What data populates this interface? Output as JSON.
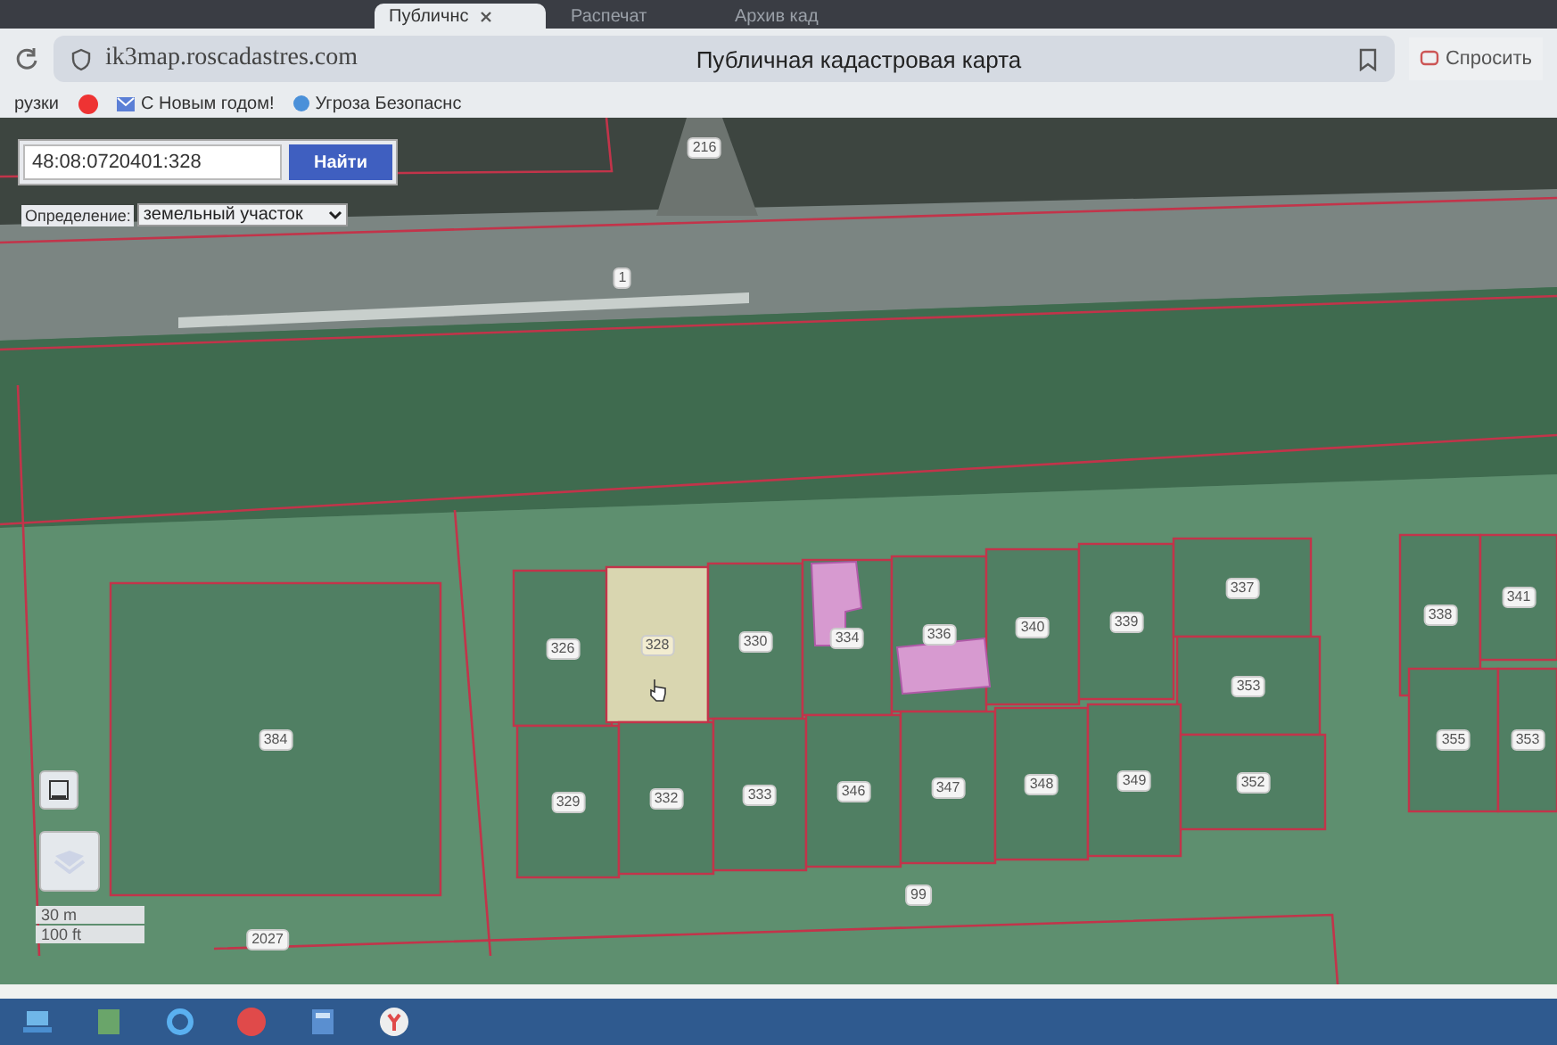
{
  "tabs": [
    {
      "label": "Публичнс",
      "selected": true
    },
    {
      "label": "Распечат",
      "selected": false
    },
    {
      "label": "Архив кад",
      "selected": false
    }
  ],
  "address_bar": {
    "url": "ik3map.roscadastres.com",
    "page_title": "Публичная кадастровая карта",
    "ask_button": "Спросить"
  },
  "bookmarks": [
    "рузки",
    "С Новым годом!",
    "Угроза Безопаснс"
  ],
  "search": {
    "value": "48:08:0720401:328",
    "button": "Найти"
  },
  "definition": {
    "label": "Определение:",
    "value": "земельный участок"
  },
  "parcels": [
    {
      "label": "326",
      "selected": false
    },
    {
      "label": "328",
      "selected": true
    },
    {
      "label": "330",
      "selected": false
    },
    {
      "label": "334",
      "selected": false
    },
    {
      "label": "336",
      "selected": false
    },
    {
      "label": "340",
      "selected": false
    },
    {
      "label": "339",
      "selected": false
    },
    {
      "label": "337",
      "selected": false
    },
    {
      "label": "353",
      "selected": false
    },
    {
      "label": "329",
      "selected": false
    },
    {
      "label": "332",
      "selected": false
    },
    {
      "label": "333",
      "selected": false
    },
    {
      "label": "346",
      "selected": false
    },
    {
      "label": "347",
      "selected": false
    },
    {
      "label": "348",
      "selected": false
    },
    {
      "label": "349",
      "selected": false
    },
    {
      "label": "352",
      "selected": false
    },
    {
      "label": "384",
      "selected": false
    },
    {
      "label": "338",
      "selected": false
    },
    {
      "label": "341",
      "selected": false
    },
    {
      "label": "355",
      "selected": false
    },
    {
      "label": "353",
      "selected": false
    }
  ],
  "map_labels": [
    "216",
    "1",
    "99",
    "2027"
  ],
  "scale": [
    "30 m",
    "100 ft"
  ]
}
